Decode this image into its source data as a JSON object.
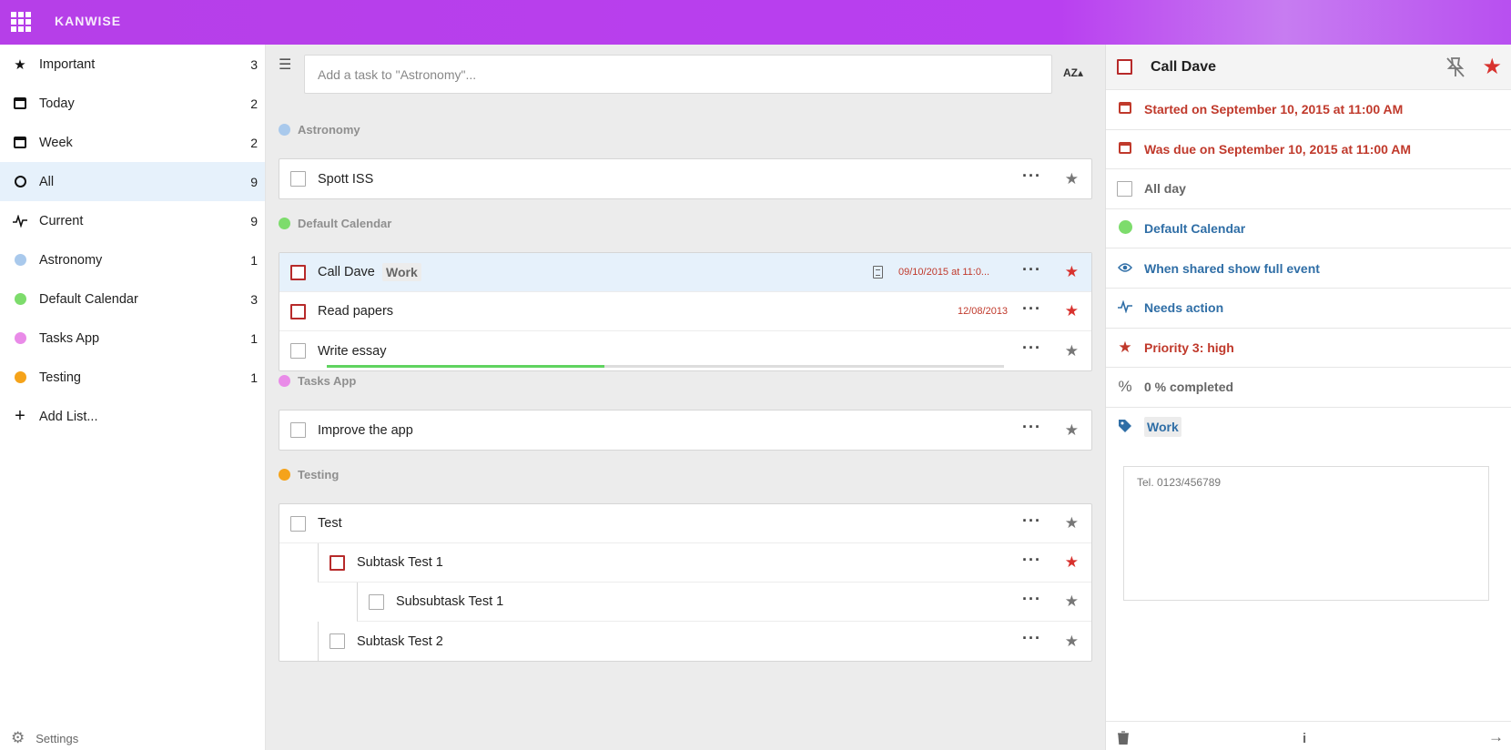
{
  "app": {
    "brand": "KANWISE"
  },
  "sidebar": {
    "items": [
      {
        "label": "Important",
        "count": "3",
        "icon": "star-icon"
      },
      {
        "label": "Today",
        "count": "2",
        "icon": "calendar-icon"
      },
      {
        "label": "Week",
        "count": "2",
        "icon": "calendar-icon"
      },
      {
        "label": "All",
        "count": "9",
        "icon": "circle-icon"
      },
      {
        "label": "Current",
        "count": "9",
        "icon": "pulse-icon"
      },
      {
        "label": "Astronomy",
        "count": "1",
        "color": "#a9c9ec"
      },
      {
        "label": "Default Calendar",
        "count": "3",
        "color": "#7ddc6c"
      },
      {
        "label": "Tasks App",
        "count": "1",
        "color": "#e98be8"
      },
      {
        "label": "Testing",
        "count": "1",
        "color": "#f5a31a"
      }
    ],
    "add_list": "Add List...",
    "settings": "Settings"
  },
  "main": {
    "add_placeholder": "Add a task to \"Astronomy\"...",
    "sort_label": "AZ▴",
    "groups": [
      {
        "name": "Astronomy",
        "color": "#a9c9ec",
        "tasks": [
          {
            "title": "Spott ISS"
          }
        ]
      },
      {
        "name": "Default Calendar",
        "color": "#7ddc6c",
        "tasks": [
          {
            "title": "Call Dave",
            "tag": "Work",
            "date": "09/10/2015 at 11:0..."
          },
          {
            "title": "Read papers",
            "date": "12/08/2013"
          },
          {
            "title": "Write essay",
            "progress": 0.41
          }
        ]
      },
      {
        "name": "Tasks App",
        "color": "#e98be8",
        "tasks": [
          {
            "title": "Improve the app"
          }
        ]
      },
      {
        "name": "Testing",
        "color": "#f5a31a",
        "tasks": [
          {
            "title": "Test"
          },
          {
            "title": "Subtask Test 1"
          },
          {
            "title": "Subsubtask Test 1"
          },
          {
            "title": "Subtask Test 2"
          }
        ]
      }
    ]
  },
  "detail": {
    "title": "Call Dave",
    "started": "Started on September 10, 2015 at 11:00 AM",
    "due": "Was due on September 10, 2015 at 11:00 AM",
    "all_day": "All day",
    "calendar": "Default Calendar",
    "calendar_color": "#7ddc6c",
    "visibility": "When shared show full event",
    "status": "Needs action",
    "priority": "Priority 3: high",
    "completed": "0 % completed",
    "tag": "Work",
    "notes": "Tel. 0123/456789"
  },
  "colors": {
    "accent": "#b63fe8",
    "overdue": "#c0392b",
    "link": "#2f6ea6",
    "star_active": "#d8322e"
  }
}
